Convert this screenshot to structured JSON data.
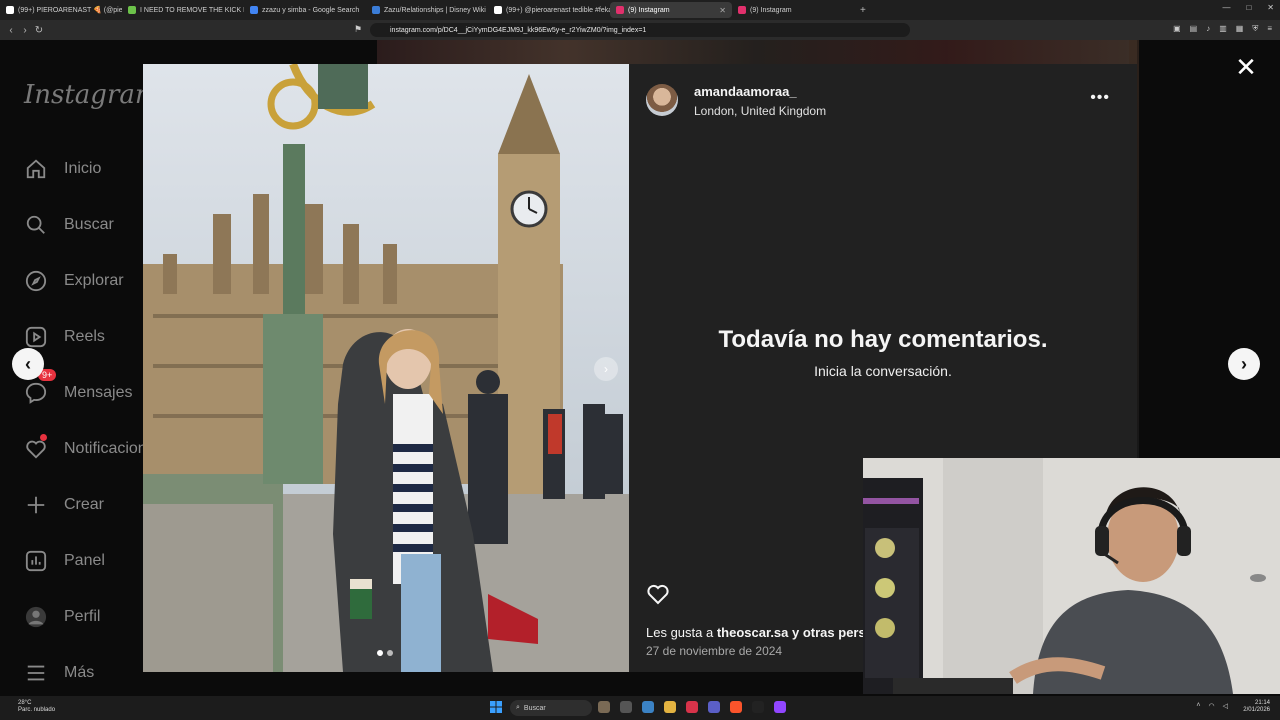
{
  "browser": {
    "tabs": [
      {
        "label": "(99+) PIEROARENAST 🍕 (@pieroare",
        "color": "#ffffff",
        "active": false
      },
      {
        "label": "I NEED TO REMOVE THE KICK LIMIT!!",
        "color": "#6cc24a",
        "active": false
      },
      {
        "label": "zzazu y simba - Google Search",
        "color": "#4285f4",
        "active": false
      },
      {
        "label": "Zazu/Relationships | Disney Wiki | Fa",
        "color": "#3b7dd8",
        "active": false
      },
      {
        "label": "(99+) @pieroarenast tedible #fekahc",
        "color": "#ffffff",
        "active": false
      },
      {
        "label": "(9) Instagram",
        "color": "#e1306c",
        "active": true
      },
      {
        "label": "(9) Instagram",
        "color": "#e1306c",
        "active": false
      }
    ],
    "url": "instagram.com/p/DC4__jCiYymDG4EJM9J_kk96Ew5y-e_r2YiwZM0/?img_index=1"
  },
  "sidebar": {
    "logo": "Instagram",
    "items": [
      {
        "label": "Inicio",
        "icon": "home-icon"
      },
      {
        "label": "Buscar",
        "icon": "search-icon"
      },
      {
        "label": "Explorar",
        "icon": "compass-icon"
      },
      {
        "label": "Reels",
        "icon": "reels-icon"
      },
      {
        "label": "Mensajes",
        "icon": "messenger-icon",
        "badge": "9+"
      },
      {
        "label": "Notificaciones",
        "icon": "heart-icon"
      },
      {
        "label": "Crear",
        "icon": "plus-icon"
      },
      {
        "label": "Panel",
        "icon": "dashboard-icon"
      },
      {
        "label": "Perfil",
        "icon": "profile-avatar"
      },
      {
        "label": "Más",
        "icon": "menu-icon"
      }
    ]
  },
  "post": {
    "username": "amandaamoraa_",
    "location": "London, United Kingdom",
    "no_comments_title": "Todavía no hay comentarios.",
    "no_comments_subtitle": "Inicia la conversación.",
    "likes_prefix": "Les gusta a",
    "likes_user": "theoscar.sa",
    "likes_suffix": "y otras pers",
    "date": "27 de noviembre de 2024",
    "carousel_position": 1,
    "carousel_count": 2
  },
  "taskbar": {
    "weather_temp": "28°C",
    "weather_desc": "Parc. nublado",
    "search_placeholder": "Buscar",
    "time": "21:14",
    "date": "2/01/2026"
  },
  "colors": {
    "modal_panel": "#212121",
    "background": "#0b0b0b",
    "badge": "#e8323f"
  }
}
